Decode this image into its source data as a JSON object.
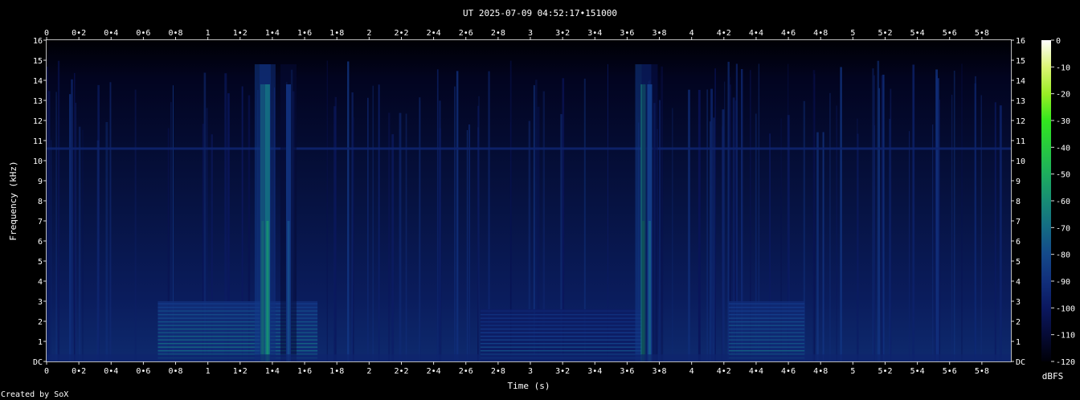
{
  "chart_data": {
    "type": "heatmap",
    "title": "UT 2025-07-09 04:52:17•151000",
    "xlabel": "Time (s)",
    "ylabel": "Frequency (kHz)",
    "xlim": [
      0,
      5.98
    ],
    "ylim": [
      0,
      16
    ],
    "x_ticks": [
      "0",
      "0•2",
      "0•4",
      "0•6",
      "0•8",
      "1",
      "1•2",
      "1•4",
      "1•6",
      "1•8",
      "2",
      "2•2",
      "2•4",
      "2•6",
      "2•8",
      "3",
      "3•2",
      "3•4",
      "3•6",
      "3•8",
      "4",
      "4•2",
      "4•4",
      "4•6",
      "4•8",
      "5",
      "5•2",
      "5•4",
      "5•6",
      "5•8"
    ],
    "y_ticks": [
      "DC",
      "1",
      "2",
      "3",
      "4",
      "5",
      "6",
      "7",
      "8",
      "9",
      "10",
      "11",
      "12",
      "13",
      "14",
      "15",
      "16"
    ],
    "colorbar": {
      "label": "dBFS",
      "range": [
        -120,
        0
      ],
      "ticks": [
        "0",
        "-10",
        "-20",
        "-30",
        "-40",
        "-50",
        "-60",
        "-70",
        "-80",
        "-90",
        "-100",
        "-110",
        "-120"
      ]
    },
    "tone_khz": 10.6,
    "broadband_events": [
      {
        "t": 1.34,
        "level_dbfs": -55
      },
      {
        "t": 1.37,
        "level_dbfs": -60
      },
      {
        "t": 1.5,
        "level_dbfs": -80
      },
      {
        "t": 3.7,
        "level_dbfs": -55
      },
      {
        "t": 3.74,
        "level_dbfs": -75
      }
    ],
    "low_band_segments": [
      {
        "t_start": 0.69,
        "t_end": 1.68,
        "max_khz": 3.0,
        "level_dbfs": -80
      },
      {
        "t_start": 2.69,
        "t_end": 3.7,
        "max_khz": 2.6,
        "level_dbfs": -88
      },
      {
        "t_start": 4.23,
        "t_end": 4.7,
        "max_khz": 3.0,
        "level_dbfs": -82
      }
    ]
  },
  "footer": {
    "credit": "Created by SoX"
  }
}
